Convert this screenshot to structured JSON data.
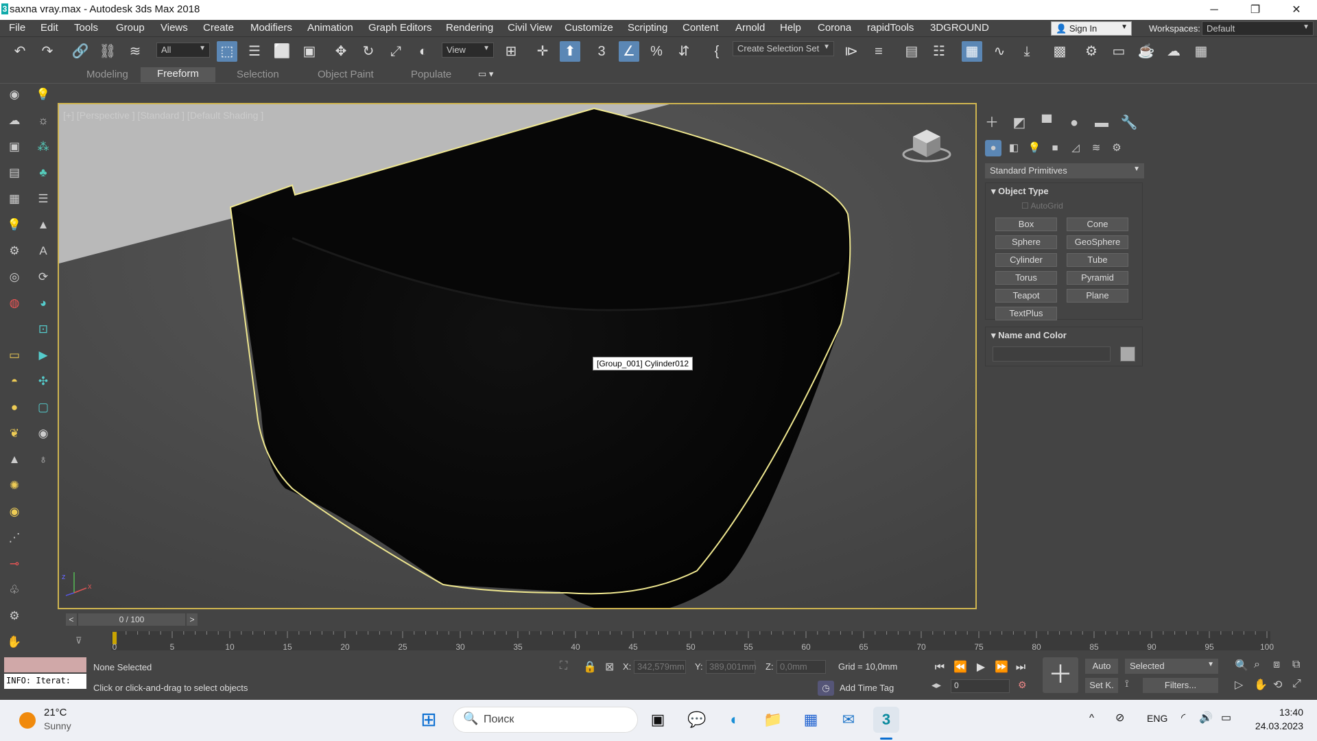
{
  "window": {
    "title": "saxna vray.max - Autodesk 3ds Max 2018",
    "min": "─",
    "restore": "❐",
    "close": "✕"
  },
  "menu": [
    "File",
    "Edit",
    "Tools",
    "Group",
    "Views",
    "Create",
    "Modifiers",
    "Animation",
    "Graph Editors",
    "Rendering",
    "Civil View",
    "Customize",
    "Scripting",
    "Content",
    "Arnold",
    "Help",
    "Corona",
    "rapidTools",
    "3DGROUND"
  ],
  "account": {
    "signin": "Sign In",
    "workspaces_label": "Workspaces:",
    "workspace": "Default"
  },
  "toolbar": {
    "filter": "All",
    "refcoord": "View",
    "selset": "Create Selection Set",
    "angle_snap": "3",
    "percent": "%"
  },
  "ribbon_tabs": [
    "Modeling",
    "Freeform",
    "Selection",
    "Object Paint",
    "Populate"
  ],
  "viewport": {
    "label": "[+] [Perspective ] [Standard ] [Default Shading ]",
    "tooltip": "[Group_001] Cylinder012",
    "axis_z": "z",
    "axis_x": "x"
  },
  "command_panel": {
    "category": "Standard Primitives",
    "object_type": {
      "title": "Object Type",
      "autogrid": "AutoGrid",
      "buttons": [
        "Box",
        "Cone",
        "Sphere",
        "GeoSphere",
        "Cylinder",
        "Tube",
        "Torus",
        "Pyramid",
        "Teapot",
        "Plane",
        "TextPlus"
      ]
    },
    "name_color": {
      "title": "Name and Color",
      "name": ""
    }
  },
  "timeline": {
    "frame": "0 / 100",
    "prev": "<",
    "next": ">",
    "ticks": [
      "0",
      "5",
      "10",
      "15",
      "20",
      "25",
      "30",
      "35",
      "40",
      "45",
      "50",
      "55",
      "60",
      "65",
      "70",
      "75",
      "80",
      "85",
      "90",
      "95",
      "100"
    ]
  },
  "status": {
    "maxscript": "INFO: Iterat:",
    "selection": "None Selected",
    "prompt": "Click or click-and-drag to select objects",
    "x_label": "X:",
    "x": "342,579mm",
    "y_label": "Y:",
    "y": "389,001mm",
    "z_label": "Z:",
    "z": "0,0mm",
    "grid": "Grid = 10,0mm",
    "add_time_tag": "Add Time Tag",
    "auto": "Auto",
    "setk": "Set K.",
    "selected": "Selected",
    "filters": "Filters...",
    "frame": "0"
  },
  "taskbar": {
    "temp": "21°C",
    "weather": "Sunny",
    "search": "Поиск",
    "lang": "ENG",
    "time": "13:40",
    "date": "24.03.2023"
  },
  "colors": {
    "accent": "#5b87b5",
    "selection_outline": "#f0e890",
    "viewport_border": "#cfb550"
  }
}
